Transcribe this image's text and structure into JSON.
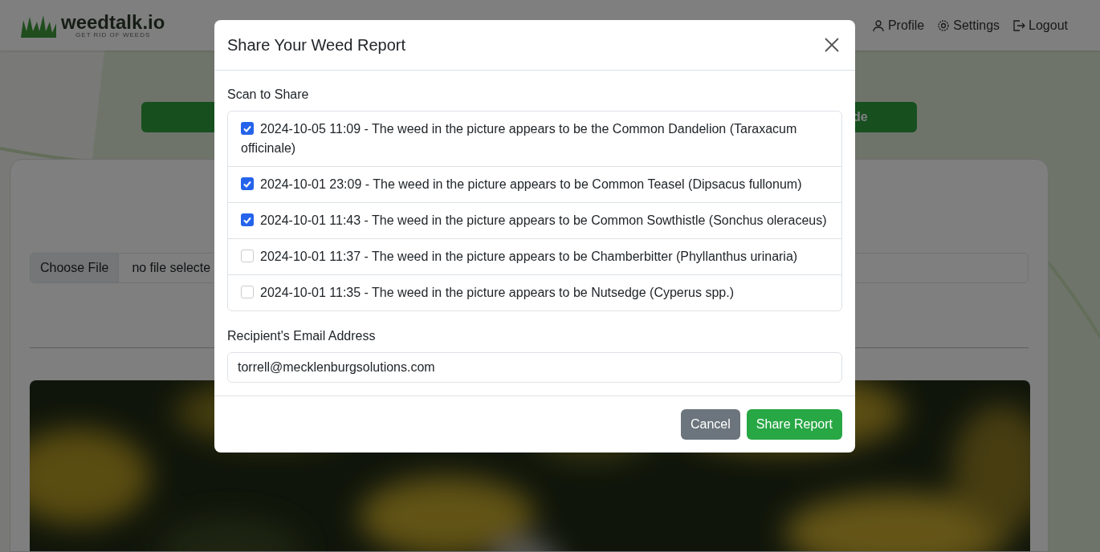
{
  "header": {
    "logo": {
      "name": "weedtalk.io",
      "tagline": "GET RID OF WEEDS"
    },
    "nav": [
      {
        "label": "Profile",
        "kind": "person"
      },
      {
        "label": "Settings",
        "kind": "gear"
      },
      {
        "label": "Logout",
        "kind": "logout"
      }
    ]
  },
  "page": {
    "action_button": {
      "label": "de"
    },
    "file_input": {
      "button": "Choose File",
      "value": "no file selecte"
    }
  },
  "modal": {
    "title": "Share Your Weed Report",
    "scan_label": "Scan to Share",
    "scans": [
      {
        "text": "2024-10-05 11:09 - The weed in the picture appears to be the Common Dandelion (Taraxacum officinale)",
        "checked": true
      },
      {
        "text": "2024-10-01 23:09 - The weed in the picture appears to be Common Teasel (Dipsacus fullonum)",
        "checked": true
      },
      {
        "text": "2024-10-01 11:43 - The weed in the picture appears to be Common Sowthistle (Sonchus oleraceus)",
        "checked": true
      },
      {
        "text": "2024-10-01 11:37 - The weed in the picture appears to be Chamberbitter (Phyllanthus urinaria)",
        "checked": false
      },
      {
        "text": "2024-10-01 11:35 - The weed in the picture appears to be Nutsedge (Cyperus spp.)",
        "checked": false
      }
    ],
    "email_label": "Recipient's Email Address",
    "email_value": "torrell@mecklenburgsolutions.com",
    "buttons": [
      {
        "label": "Cancel",
        "kind": "secondary"
      },
      {
        "label": "Share Report",
        "kind": "primary"
      }
    ]
  }
}
